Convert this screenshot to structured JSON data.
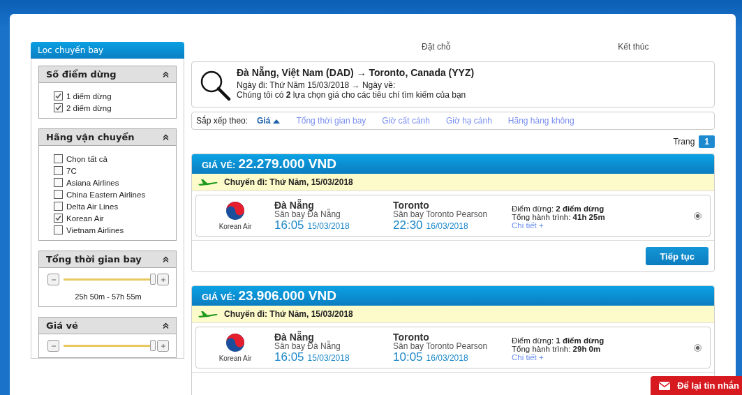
{
  "steps": [
    {
      "label": "Đặt chỗ"
    },
    {
      "label": "Kết thúc"
    }
  ],
  "sidebar": {
    "title": "Lọc chuyến bay",
    "panels": [
      {
        "kind": "checks",
        "title": "Số điểm dừng",
        "items": [
          {
            "label": "1 điểm dừng",
            "checked": true
          },
          {
            "label": "2 điểm dừng",
            "checked": true
          }
        ]
      },
      {
        "kind": "checks",
        "title": "Hãng vận chuyển",
        "items": [
          {
            "label": "Chọn tất cả",
            "checked": false
          },
          {
            "label": "7C",
            "checked": false
          },
          {
            "label": "Asiana Airlines",
            "checked": false
          },
          {
            "label": "China Eastern Airlines",
            "checked": false
          },
          {
            "label": "Delta Air Lines",
            "checked": false
          },
          {
            "label": "Korean Air",
            "checked": true
          },
          {
            "label": "Vietnam Airlines",
            "checked": false
          }
        ]
      },
      {
        "kind": "slider",
        "title": "Tổng thời gian bay",
        "level": 1,
        "range": "25h 50m - 57h 55m"
      },
      {
        "kind": "slider",
        "title": "Giá vé",
        "level": 1
      }
    ]
  },
  "search": {
    "route": "Đà Nẵng, Việt Nam (DAD) → Toronto, Canada (YYZ)",
    "dates": "Ngày đi: Thứ Năm 15/03/2018 → Ngày về:",
    "summary": "Chúng tôi có **2** lựa chọn giá cho các tiêu chí tìm kiếm của bạn"
  },
  "sort": {
    "label": "Sắp xếp theo:",
    "options": [
      {
        "label": "Giá",
        "selected": true
      },
      {
        "label": "Tổng thời gian bay",
        "selected": false
      },
      {
        "label": "Giờ cất cánh",
        "selected": false
      },
      {
        "label": "Giờ hạ cánh",
        "selected": false
      },
      {
        "label": "Hãng hàng không",
        "selected": false
      }
    ]
  },
  "pagination": {
    "label": "Trang",
    "pages": [
      {
        "label": "1",
        "selected": true
      }
    ]
  },
  "results": [
    {
      "price_label": "GIÁ VÉ:",
      "price": "22.279.000 VND",
      "leg": "Chuyến đi: Thứ Năm, 15/03/2018",
      "airline": "Korean Air",
      "from_city": "Đà Nẵng",
      "from_airport": "Sân bay Đà Nẵng",
      "dep_time": "16:05",
      "dep_date": "15/03/2018",
      "to_city": "Toronto",
      "to_airport": "Sân bay Toronto Pearson",
      "arr_time": "22:30",
      "arr_date": "16/03/2018",
      "stops": "Điểm dừng: **2 điểm dừng**",
      "duration": "Tổng hành trình: **41h 25m**",
      "details": "Chi tiết +",
      "selected": true,
      "button": "Tiếp tục"
    },
    {
      "price_label": "GIÁ VÉ:",
      "price": "23.906.000 VND",
      "leg": "Chuyến đi: Thứ Năm, 15/03/2018",
      "airline": "Korean Air",
      "from_city": "Đà Nẵng",
      "from_airport": "Sân bay Đà Nẵng",
      "dep_time": "16:05",
      "dep_date": "15/03/2018",
      "to_city": "Toronto",
      "to_airport": "Sân bay Toronto Pearson",
      "arr_time": "10:05",
      "arr_date": "16/03/2018",
      "stops": "Điểm dừng: **1 điểm dừng**",
      "duration": "Tổng hành trình: **29h 0m**",
      "details": "Chi tiết +",
      "selected": true
    }
  ],
  "chat_button": "Để lại tin nhắn"
}
